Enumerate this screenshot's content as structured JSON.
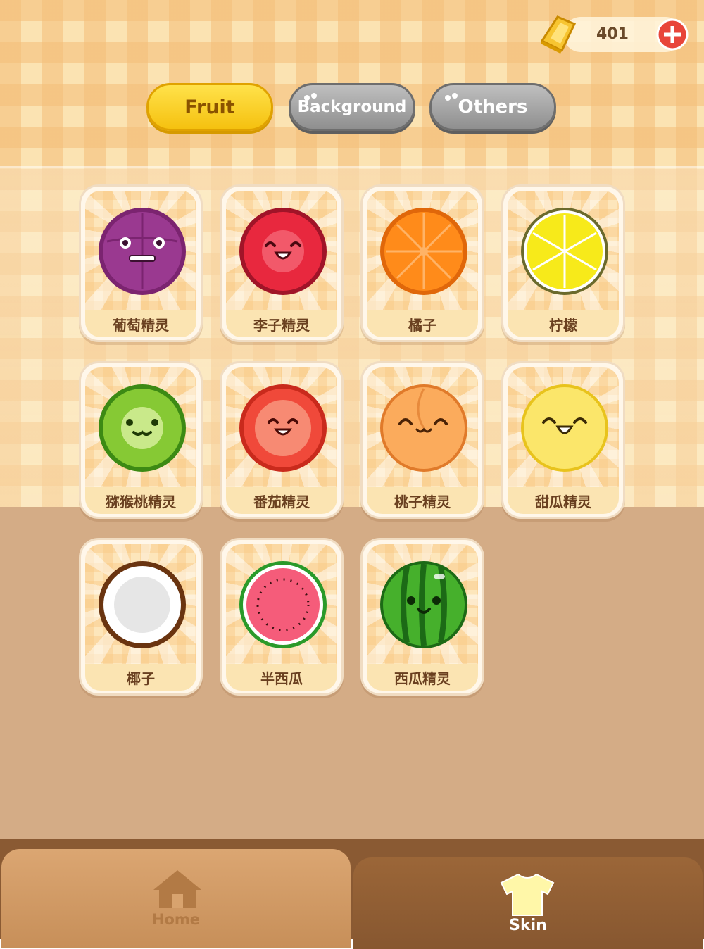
{
  "currency": {
    "amount": "401",
    "icon": "gold-bar-icon",
    "add_icon": "plus-icon"
  },
  "tabs": [
    {
      "label": "Fruit",
      "active": true
    },
    {
      "label": "Background",
      "active": false
    },
    {
      "label": "Others",
      "active": false
    }
  ],
  "skins": [
    {
      "name": "葡萄精灵",
      "fruit": "grape"
    },
    {
      "name": "李子精灵",
      "fruit": "plum"
    },
    {
      "name": "橘子",
      "fruit": "orange"
    },
    {
      "name": "柠檬",
      "fruit": "lemon"
    },
    {
      "name": "猕猴桃精灵",
      "fruit": "kiwi"
    },
    {
      "name": "番茄精灵",
      "fruit": "tomato"
    },
    {
      "name": "桃子精灵",
      "fruit": "peach"
    },
    {
      "name": "甜瓜精灵",
      "fruit": "melon"
    },
    {
      "name": "椰子",
      "fruit": "coconut"
    },
    {
      "name": "半西瓜",
      "fruit": "half-watermelon"
    },
    {
      "name": "西瓜精灵",
      "fruit": "watermelon"
    }
  ],
  "nav": {
    "home_label": "Home",
    "skin_label": "Skin",
    "active": "Skin"
  },
  "colors": {
    "active_tab": "#f5c110",
    "inactive_tab": "#9a9a9a",
    "nav_active": "#875730",
    "nav_inactive": "#c78f59"
  }
}
